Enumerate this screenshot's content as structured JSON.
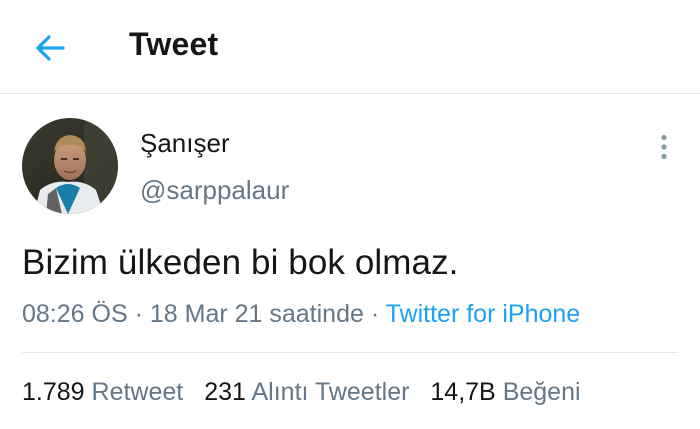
{
  "header": {
    "title": "Tweet",
    "back_icon": "arrow-left-icon"
  },
  "colors": {
    "accent": "#1da1f2",
    "text_primary": "#14171a",
    "text_secondary": "#657786",
    "divider": "#e3e6e8"
  },
  "author": {
    "display_name": "Şanışer",
    "handle": "@sarppalaur"
  },
  "tweet": {
    "text": "Bizim ülkeden bi bok olmaz.",
    "time": "08:26 ÖS",
    "separator": " · ",
    "date": "18 Mar 21 saatinde",
    "source": "Twitter for iPhone"
  },
  "stats": [
    {
      "count": "1.789",
      "label": "Retweet"
    },
    {
      "count": "231",
      "label": "Alıntı Tweetler"
    },
    {
      "count": "14,7B",
      "label": "Beğeni"
    }
  ]
}
